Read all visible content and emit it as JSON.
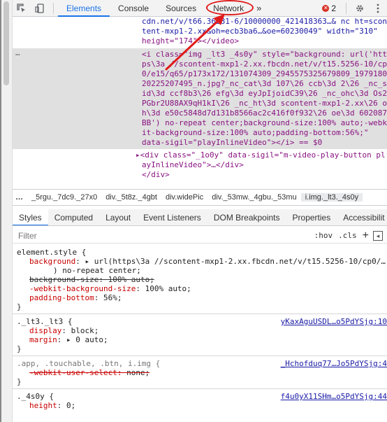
{
  "toolbar": {
    "tabs": [
      "Elements",
      "Console",
      "Sources",
      "Network"
    ],
    "more": "»",
    "error_count": "2"
  },
  "dom": {
    "lines_top": [
      "cdn.net/v/t66.36281-6/10000000_421418363…& nc ht=scon",
      "tent-mxp1-2.xx&oh=ecb3ba6…&oe=60230049\" width=\"310\"",
      "height=\"174\"></video>"
    ],
    "selected": [
      "<i class=\"img _lt3 _4s0y\" style=\"background: url('htt",
      "ps\\3a //scontent-mxp1-2.xx.fbcdn.net/v/t15.5256-10/cp",
      "0/e15/q65/p173x172/131074309_2945575325679809_1979180",
      "20225207495_n.jpg?_nc_cat\\3d 107\\26 ccb\\3d 2\\26 _nc_s",
      "id\\3d ccf8b3\\26 efg\\3d eyJpIjoidC39\\26 _nc_ohc\\3d Os2",
      "PGbr2U88AX9qH1kI\\26 _nc_ht\\3d scontent-mxp1-2.xx\\26 o",
      "h\\3d e50c5848d7d131b8566ac2c416f0f932\\26 oe\\3d 602087",
      "BB') no-repeat center;background-size:100% auto;-webk",
      "it-background-size:100% auto;padding-bottom:56%;\"",
      "data-sigil=\"playInlineVideo\"></i> == $0"
    ],
    "lines_after": [
      "▸<div class=\"_1o0y\" data-sigil=\"m-video-play-button pl",
      "ayInlineVideo\">…</div>",
      "</div>"
    ],
    "ellipsis": "…"
  },
  "breadcrumbs": [
    "…",
    "_5rgu._7dc9._27x0",
    "div._5t8z._4gbt",
    "div.widePic",
    "div._53mw._4gbu._53mu",
    "i.img._lt3._4s0y"
  ],
  "styles_tabs": [
    "Styles",
    "Computed",
    "Layout",
    "Event Listeners",
    "DOM Breakpoints",
    "Properties",
    "Accessibilit"
  ],
  "filter": {
    "placeholder": "Filter",
    "hov": ":hov",
    "cls": ".cls",
    "plus": "+"
  },
  "rules": [
    {
      "selector": "element.style {",
      "source": "",
      "props": [
        {
          "name": "background",
          "value": "▸ url(https\\3a //scontent-mxp1-2.xx.fbcdn.net/v/t15.5256-10/cp0/…",
          "strike": false
        },
        {
          "name": "",
          "value": ") no-repeat center;",
          "strike": false,
          "cont": true
        },
        {
          "name": "background-size",
          "value": "100% auto;",
          "strike": true
        },
        {
          "name": "-webkit-background-size",
          "value": "100% auto;",
          "strike": false
        },
        {
          "name": "padding-bottom",
          "value": "56%;",
          "strike": false
        }
      ],
      "close": "}"
    },
    {
      "selector": "._lt3._lt3 {",
      "source": "yKaxAguUSDL…o5PdYSjg:10",
      "props": [
        {
          "name": "display",
          "value": "block;",
          "strike": false
        },
        {
          "name": "margin",
          "value": "▸ 0 auto;",
          "strike": false
        }
      ],
      "close": "}"
    },
    {
      "selector": ".app, .touchable, .btn, i.img {",
      "source": "_Hchofduq77…Jo5PdYSjg:4",
      "props": [
        {
          "name": "-webkit-user-select",
          "value": "none;",
          "strike": true
        }
      ],
      "close": "}"
    },
    {
      "selector": "._4s0y {",
      "source": "f4u0yX11SHm…o5PdYSjg:44",
      "props": [
        {
          "name": "height",
          "value": "0;",
          "strike": false
        }
      ],
      "close": ""
    }
  ]
}
